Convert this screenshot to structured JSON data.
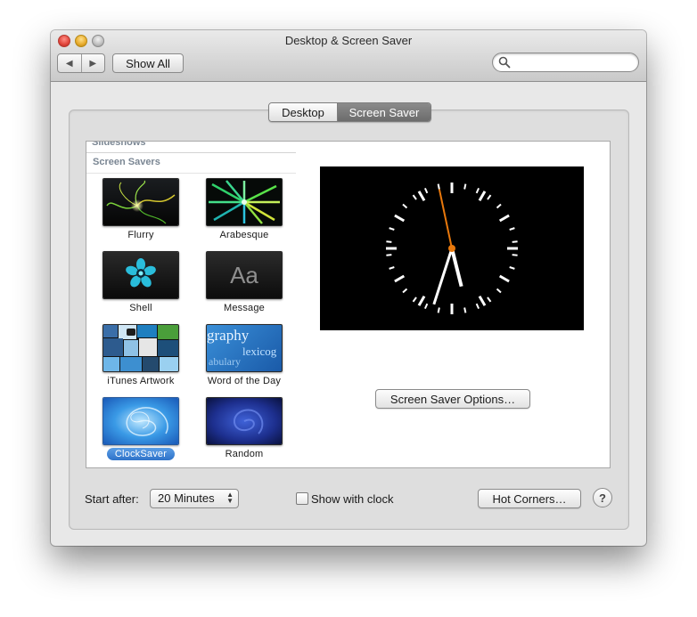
{
  "window": {
    "title": "Desktop & Screen Saver"
  },
  "toolbar": {
    "back_glyph": "◀",
    "forward_glyph": "▶",
    "show_all_label": "Show All",
    "search": {
      "value": "",
      "placeholder": ""
    }
  },
  "tabs": [
    {
      "label": "Desktop",
      "selected": false
    },
    {
      "label": "Screen Saver",
      "selected": true
    }
  ],
  "list": {
    "partial_header": "Slideshows",
    "section_header": "Screen Savers",
    "items": [
      {
        "label": "Flurry",
        "icon": "flurry-thumbnail"
      },
      {
        "label": "Arabesque",
        "icon": "arabesque-thumbnail"
      },
      {
        "label": "Shell",
        "icon": "shell-thumbnail"
      },
      {
        "label": "Message",
        "icon": "message-thumbnail",
        "thumb_text": "Aa"
      },
      {
        "label": "iTunes Artwork",
        "icon": "itunes-artwork-thumbnail"
      },
      {
        "label": "Word of the Day",
        "icon": "word-of-the-day-thumbnail",
        "thumb_words": [
          "graphy",
          "lexicog",
          "abulary"
        ]
      },
      {
        "label": "ClockSaver",
        "icon": "clocksaver-thumbnail",
        "selected": true
      },
      {
        "label": "Random",
        "icon": "random-thumbnail"
      }
    ]
  },
  "preview": {
    "type": "analog-clock",
    "time": {
      "hour": 5,
      "minute": 32,
      "second": 58
    },
    "colors": {
      "background": "#000000",
      "hands": "#ffffff",
      "second_hand": "#e8780c"
    }
  },
  "options_button_label": "Screen Saver Options…",
  "bottom": {
    "start_after_label": "Start after:",
    "start_after_value": "20 Minutes",
    "show_clock_label": "Show with clock",
    "show_clock_checked": false,
    "hot_corners_label": "Hot Corners…",
    "help_label": "?"
  },
  "colors": {
    "selection": "#3a7fd5",
    "window_bg": "#e8e8e8"
  }
}
